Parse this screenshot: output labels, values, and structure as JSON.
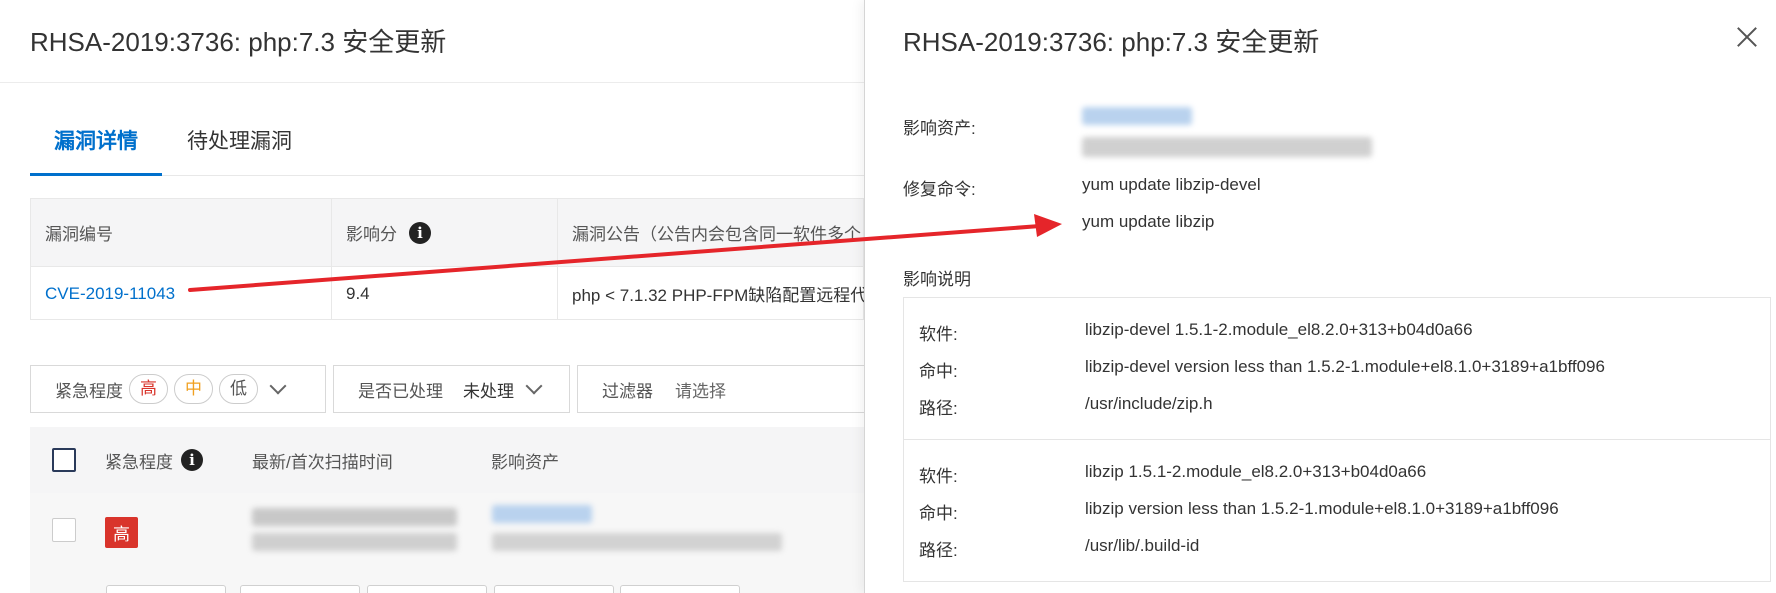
{
  "left": {
    "title": "RHSA-2019:3736: php:7.3 安全更新",
    "tabs": [
      {
        "label": "漏洞详情",
        "active": true
      },
      {
        "label": "待处理漏洞",
        "active": false
      }
    ],
    "vuln_table": {
      "headers": [
        "漏洞编号",
        "影响分",
        "漏洞公告（公告内会包含同一软件多个"
      ],
      "row": {
        "cve": "CVE-2019-11043",
        "score": "9.4",
        "notice": "php < 7.1.32 PHP-FPM缺陷配置远程代"
      }
    },
    "filters": {
      "severity_label": "紧急程度",
      "severity_options": [
        "高",
        "中",
        "低"
      ],
      "handled_label": "是否已处理",
      "handled_value": "未处理",
      "filter_label": "过滤器",
      "filter_placeholder": "请选择"
    },
    "list_headers": {
      "severity": "紧急程度",
      "scan_time": "最新/首次扫描时间",
      "asset": "影响资产"
    },
    "list_row": {
      "severity": "高"
    }
  },
  "drawer": {
    "title": "RHSA-2019:3736: php:7.3 安全更新",
    "affected_assets_label": "影响资产:",
    "fix_command_label": "修复命令:",
    "fix_commands": [
      "yum update libzip-devel",
      "yum update libzip"
    ],
    "impact_label": "影响说明",
    "details": [
      {
        "software_label": "软件:",
        "software": "libzip-devel 1.5.1-2.module_el8.2.0+313+b04d0a66",
        "match_label": "命中:",
        "match": "libzip-devel version less than 1.5.2-1.module+el8.1.0+3189+a1bff096",
        "path_label": "路径:",
        "path": "/usr/include/zip.h"
      },
      {
        "software_label": "软件:",
        "software": "libzip 1.5.1-2.module_el8.2.0+313+b04d0a66",
        "match_label": "命中:",
        "match": "libzip version less than 1.5.2-1.module+el8.1.0+3189+a1bff096",
        "path_label": "路径:",
        "path": "/usr/lib/.build-id"
      }
    ]
  },
  "colors": {
    "link": "#0070cc",
    "danger": "#d9342b",
    "warning": "#f0a020",
    "arrow": "#e5252a"
  },
  "icons": [
    "info-icon",
    "close-icon",
    "chevron-down-icon",
    "annotation-arrow"
  ]
}
